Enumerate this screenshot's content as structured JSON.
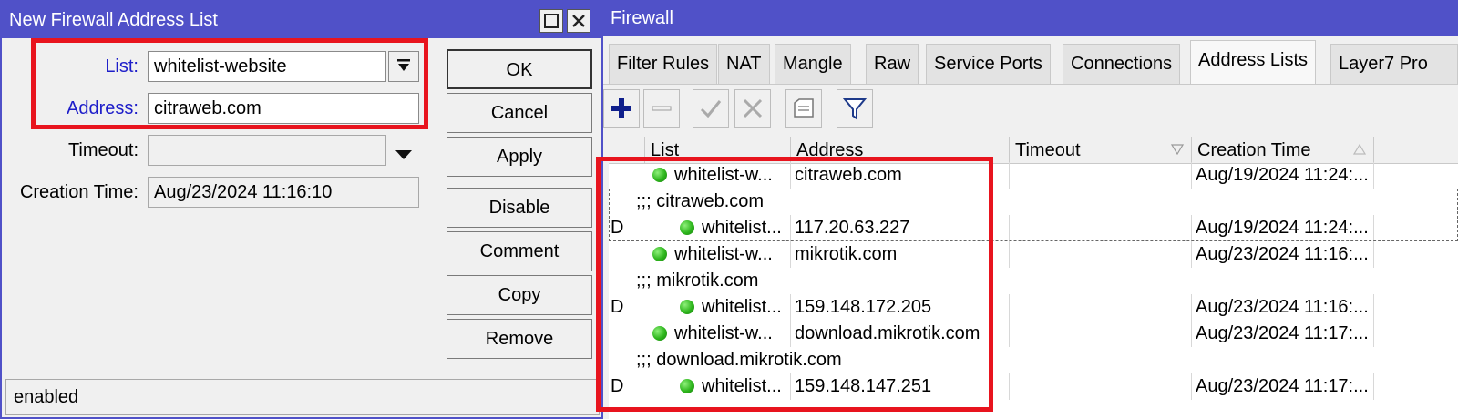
{
  "dialog": {
    "title": "New Firewall Address List",
    "fields": {
      "list_label": "List:",
      "list_value": "whitelist-website",
      "address_label": "Address:",
      "address_value": "citraweb.com",
      "timeout_label": "Timeout:",
      "timeout_value": "",
      "creation_label": "Creation Time:",
      "creation_value": "Aug/23/2024 11:16:10"
    },
    "buttons": [
      "OK",
      "Cancel",
      "Apply",
      "Disable",
      "Comment",
      "Copy",
      "Remove"
    ],
    "status": "enabled"
  },
  "firewall": {
    "title": "Firewall",
    "tabs": [
      "Filter Rules",
      "NAT",
      "Mangle",
      "Raw",
      "Service Ports",
      "Connections",
      "Address Lists",
      "Layer7 Pro"
    ],
    "active_tab": "Address Lists",
    "toolbar_icons": [
      "add-icon",
      "remove-icon",
      "enable-icon",
      "disable-icon",
      "comment-icon",
      "filter-icon"
    ],
    "columns": [
      "List",
      "Address",
      "Timeout",
      "Creation Time"
    ],
    "rows": [
      {
        "flag": "",
        "type": "entry",
        "list": "whitelist-w...",
        "address": "citraweb.com",
        "timeout": "",
        "creation": "Aug/19/2024 11:24:..."
      },
      {
        "flag": "",
        "type": "comment",
        "text": ";;; citraweb.com"
      },
      {
        "flag": "D",
        "type": "entry",
        "list": "whitelist...",
        "address": "117.20.63.227",
        "timeout": "",
        "creation": "Aug/19/2024 11:24:..."
      },
      {
        "flag": "",
        "type": "entry",
        "list": "whitelist-w...",
        "address": "mikrotik.com",
        "timeout": "",
        "creation": "Aug/23/2024 11:16:..."
      },
      {
        "flag": "",
        "type": "comment",
        "text": ";;; mikrotik.com"
      },
      {
        "flag": "D",
        "type": "entry",
        "list": "whitelist...",
        "address": "159.148.172.205",
        "timeout": "",
        "creation": "Aug/23/2024 11:16:..."
      },
      {
        "flag": "",
        "type": "entry",
        "list": "whitelist-w...",
        "address": "download.mikrotik.com",
        "timeout": "",
        "creation": "Aug/23/2024 11:17:..."
      },
      {
        "flag": "",
        "type": "comment",
        "text": ";;; download.mikrotik.com"
      },
      {
        "flag": "D",
        "type": "entry",
        "list": "whitelist...",
        "address": "159.148.147.251",
        "timeout": "",
        "creation": "Aug/23/2024 11:17:..."
      }
    ]
  },
  "colors": {
    "titlebar": "#5051c8",
    "highlight_box": "#e8141e",
    "blue_label": "#1d1dc9",
    "status_dot": "#2db51c"
  }
}
